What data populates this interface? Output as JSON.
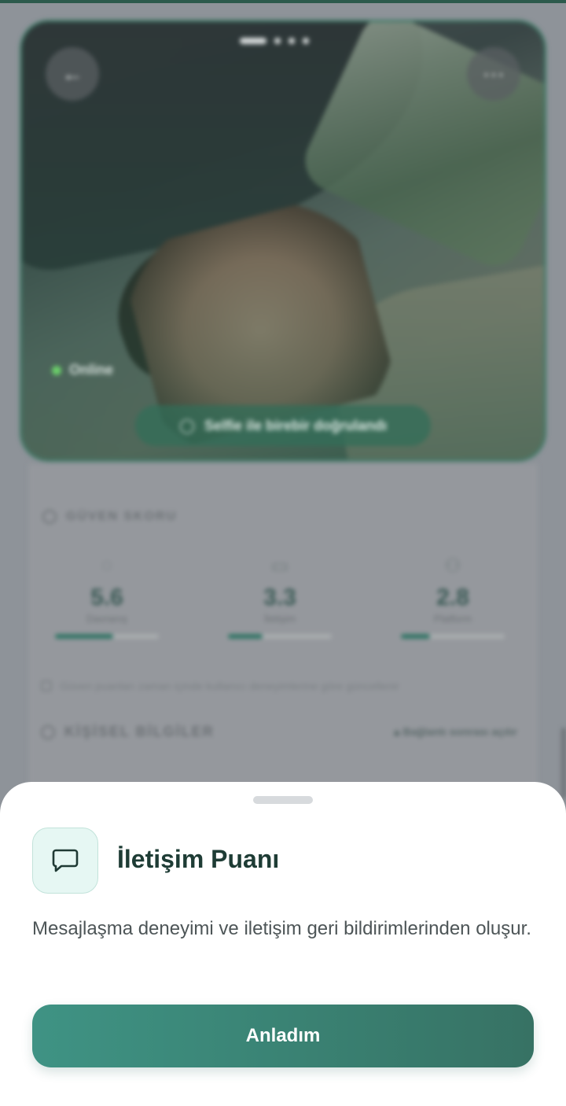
{
  "profile": {
    "status_text": "Online",
    "verified_text": "Selfie ile birebir doğrulandı"
  },
  "trust": {
    "heading": "GÜVEN SKORU",
    "stats": [
      {
        "label": "Davranış",
        "value": "5.6",
        "progress": 0.56,
        "icon": "shield-icon"
      },
      {
        "label": "İletişim",
        "value": "3.3",
        "progress": 0.33,
        "icon": "chat-bubble-icon"
      },
      {
        "label": "Platform",
        "value": "2.8",
        "progress": 0.28,
        "icon": "people-icon"
      }
    ],
    "note": "Güven puanları zaman içinde kullanıcı deneyimlerine göre güncellenir"
  },
  "personal": {
    "heading": "KİŞİSEL BİLGİLER",
    "action": "Bağlantı sonrası açılır"
  },
  "sheet": {
    "title": "İletişim Puanı",
    "description": "Mesajlaşma deneyimi ve iletişim geri bildirimlerinden oluşur.",
    "button": "Anladım",
    "icon": "chat-bubble-icon"
  },
  "colors": {
    "accent": "#3a8374",
    "accent_light": "#e6f7f3",
    "title": "#1e3c35"
  }
}
